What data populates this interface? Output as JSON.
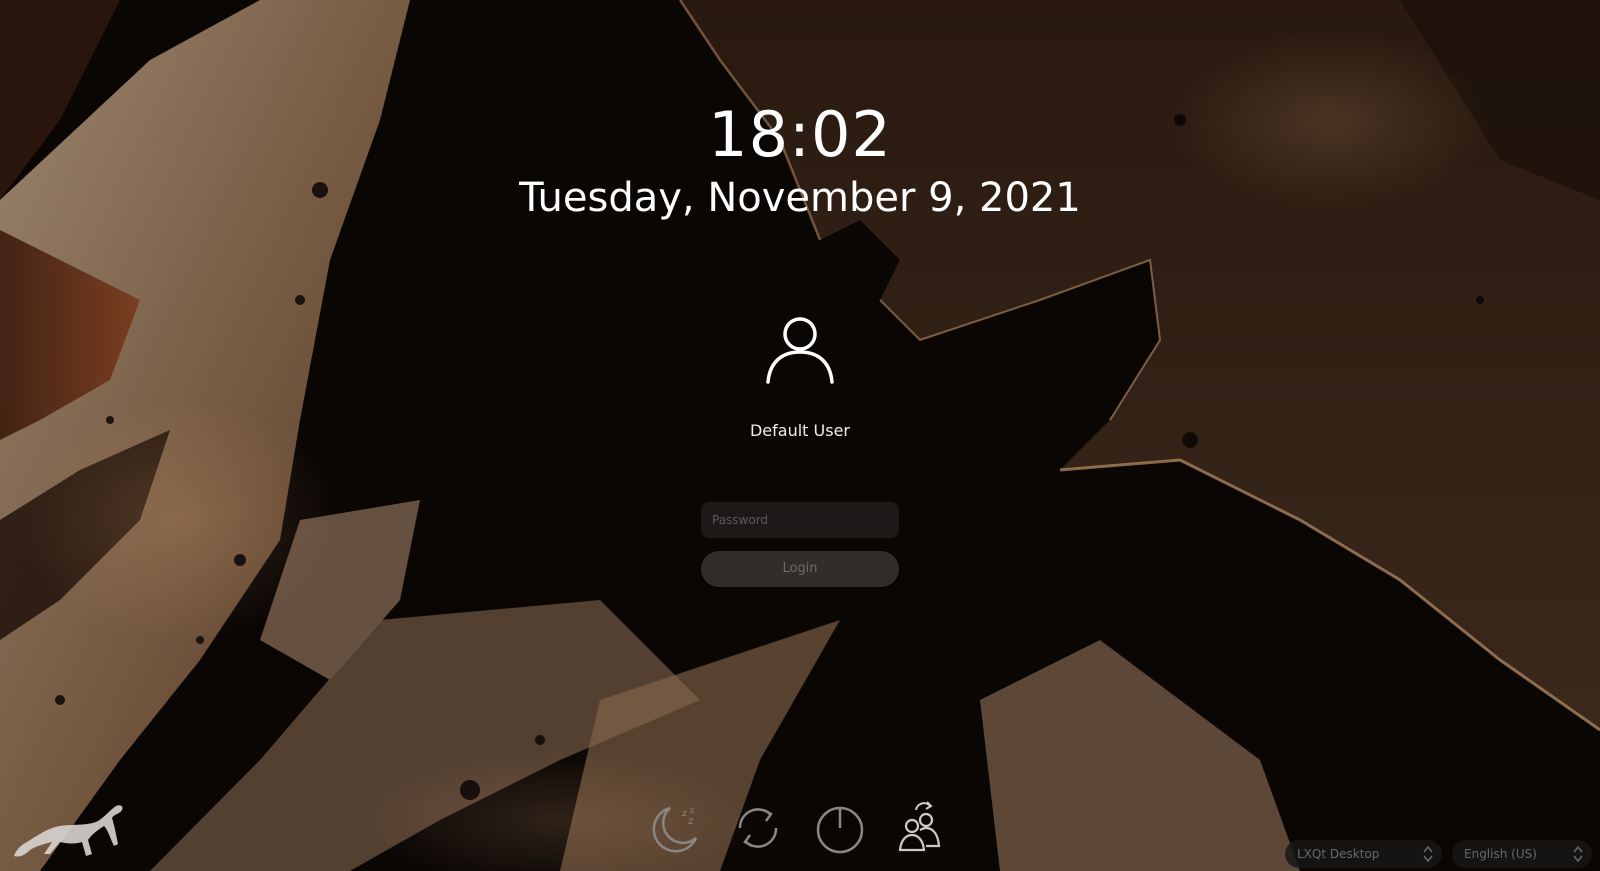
{
  "clock": {
    "time": "18:02",
    "date": "Tuesday, November 9, 2021"
  },
  "user": {
    "name": "Default User",
    "avatar_icon": "user-icon"
  },
  "login_form": {
    "password_placeholder": "Password",
    "login_label": "Login"
  },
  "power_actions": [
    {
      "icon": "suspend-icon"
    },
    {
      "icon": "reboot-icon"
    },
    {
      "icon": "shutdown-icon"
    },
    {
      "icon": "switch-user-icon"
    }
  ],
  "logo_icon": "leopard-logo-icon",
  "session_selector": {
    "value": "LXQt Desktop"
  },
  "language_selector": {
    "value": "English (US)"
  },
  "colors": {
    "text": "#ffffff",
    "field_background": "#1e1c1b",
    "button_background": "#343230",
    "muted_text": "#6e6a67"
  }
}
